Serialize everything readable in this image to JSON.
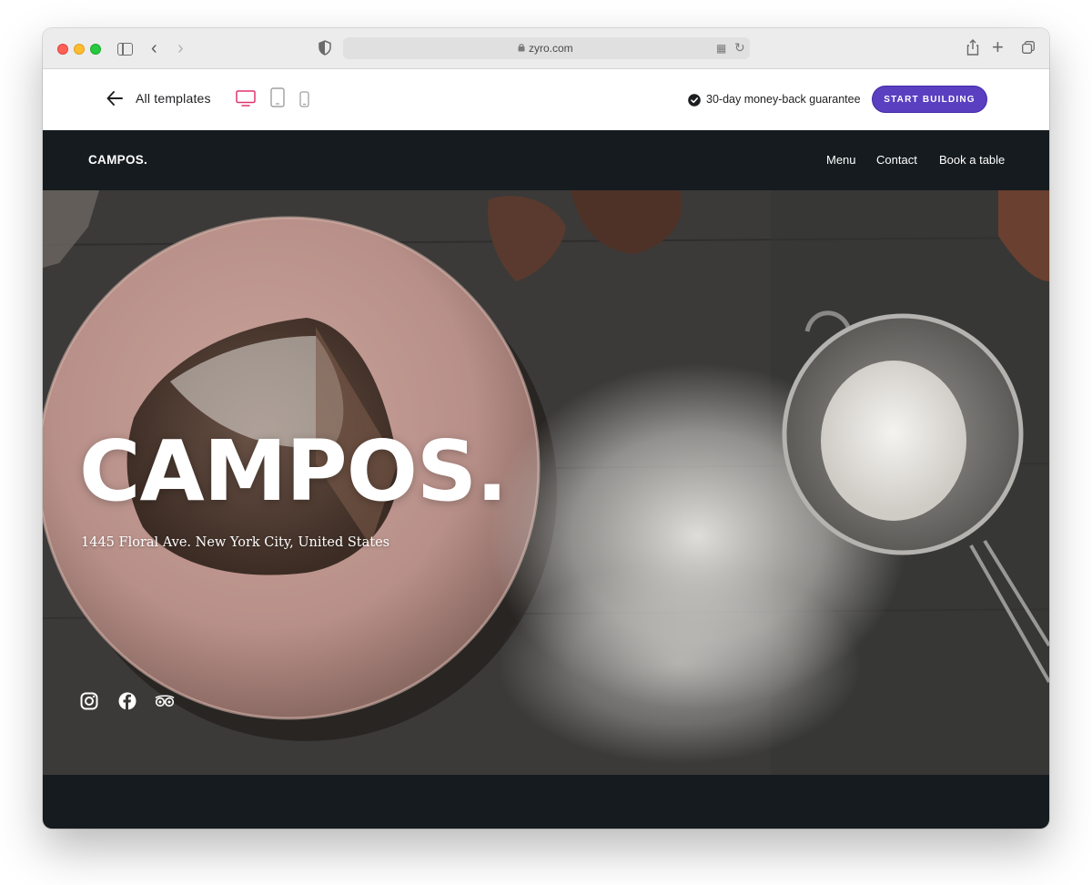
{
  "browser": {
    "url": "zyro.com"
  },
  "template_bar": {
    "back_label": "All templates",
    "guarantee_text": "30-day money-back guarantee",
    "start_button": "START BUILDING",
    "accent_color": "#5a3fc0",
    "active_device_color": "#e0356b"
  },
  "site": {
    "logo": "CAMPOS.",
    "nav": [
      "Menu",
      "Contact",
      "Book a table"
    ],
    "hero": {
      "title": "CAMPOS.",
      "address": "1445 Floral Ave. New York City, United States"
    },
    "social_icons": [
      "instagram-icon",
      "facebook-icon",
      "tripadvisor-icon"
    ],
    "nav_bg_color": "#151b1f"
  }
}
